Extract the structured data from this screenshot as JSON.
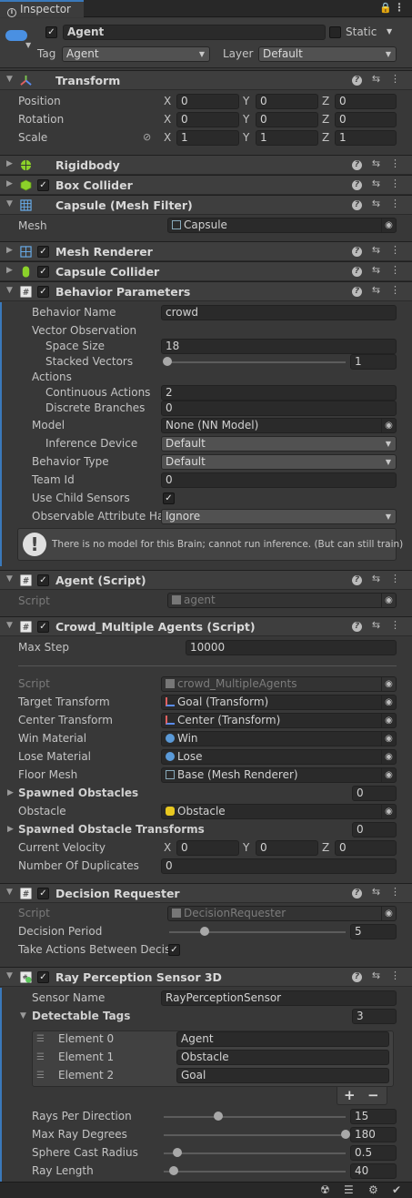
{
  "tab": {
    "title": "Inspector"
  },
  "gameobject": {
    "name": "Agent",
    "static_label": "Static",
    "tag_label": "Tag",
    "tag_value": "Agent",
    "layer_label": "Layer",
    "layer_value": "Default"
  },
  "transform": {
    "title": "Transform",
    "position_label": "Position",
    "rotation_label": "Rotation",
    "scale_label": "Scale",
    "position": {
      "x": "0",
      "y": "0",
      "z": "0"
    },
    "rotation": {
      "x": "0",
      "y": "0",
      "z": "0"
    },
    "scale": {
      "x": "1",
      "y": "1",
      "z": "1"
    },
    "axis": {
      "x": "X",
      "y": "Y",
      "z": "Z"
    }
  },
  "components": {
    "rigidbody": "Rigidbody",
    "box_collider": "Box Collider",
    "mesh_filter": "Capsule (Mesh Filter)",
    "mesh_label": "Mesh",
    "mesh_value": "Capsule",
    "mesh_renderer": "Mesh Renderer",
    "capsule_collider": "Capsule Collider"
  },
  "behavior": {
    "title": "Behavior Parameters",
    "name_label": "Behavior Name",
    "name_value": "crowd",
    "vector_obs_label": "Vector Observation",
    "space_size_label": "Space Size",
    "space_size_value": "18",
    "stacked_label": "Stacked Vectors",
    "stacked_value": "1",
    "stacked_fraction": 0,
    "actions_label": "Actions",
    "continuous_label": "Continuous Actions",
    "continuous_value": "2",
    "discrete_label": "Discrete Branches",
    "discrete_value": "0",
    "model_label": "Model",
    "model_value": "None (NN Model)",
    "inference_label": "Inference Device",
    "inference_value": "Default",
    "btype_label": "Behavior Type",
    "btype_value": "Default",
    "team_label": "Team Id",
    "team_value": "0",
    "child_label": "Use Child Sensors",
    "observable_label": "Observable Attribute Har",
    "observable_value": "Ignore",
    "help_message": "There is no model for this Brain; cannot run inference. (But can still train)"
  },
  "agent_script": {
    "title": "Agent (Script)",
    "script_label": "Script",
    "script_value": "agent"
  },
  "crowd": {
    "title": "Crowd_Multiple Agents (Script)",
    "maxstep_label": "Max Step",
    "maxstep_value": "10000",
    "script_label": "Script",
    "script_value": "crowd_MultipleAgents",
    "target_label": "Target Transform",
    "target_value": "Goal (Transform)",
    "center_label": "Center Transform",
    "center_value": "Center (Transform)",
    "win_label": "Win Material",
    "win_value": "Win",
    "lose_label": "Lose Material",
    "lose_value": "Lose",
    "floor_label": "Floor Mesh",
    "floor_value": "Base (Mesh Renderer)",
    "spawned_label": "Spawned Obstacles",
    "spawned_value": "0",
    "obstacle_label": "Obstacle",
    "obstacle_value": "Obstacle",
    "spawned_tr_label": "Spawned Obstacle Transforms",
    "spawned_tr_value": "0",
    "velocity_label": "Current Velocity",
    "velocity": {
      "x": "0",
      "y": "0",
      "z": "0"
    },
    "dup_label": "Number Of Duplicates",
    "dup_value": "0"
  },
  "decision": {
    "title": "Decision Requester",
    "script_label": "Script",
    "script_value": "DecisionRequester",
    "period_label": "Decision Period",
    "period_value": "5",
    "period_fraction": 0.2,
    "take_label": "Take Actions Between Decis"
  },
  "ray": {
    "title": "Ray Perception Sensor 3D",
    "sensor_label": "Sensor Name",
    "sensor_value": "RayPerceptionSensor",
    "tags_label": "Detectable Tags",
    "tags_count": "3",
    "elements": [
      {
        "label": "Element 0",
        "value": "Agent"
      },
      {
        "label": "Element 1",
        "value": "Obstacle"
      },
      {
        "label": "Element 2",
        "value": "Goal"
      }
    ],
    "add_label": "+",
    "remove_label": "−",
    "rays_label": "Rays Per Direction",
    "rays_value": "15",
    "rays_fraction": 0.3,
    "maxdeg_label": "Max Ray Degrees",
    "maxdeg_value": "180",
    "maxdeg_fraction": 1.0,
    "sphere_label": "Sphere Cast Radius",
    "sphere_value": "0.5",
    "sphere_fraction": 0.05,
    "length_label": "Ray Length",
    "length_value": "40",
    "length_fraction": 0.04
  },
  "colors": {
    "accent": "#3a79bb",
    "panel": "#383838",
    "header": "#3e3e3e",
    "field": "#2a2a2a"
  }
}
